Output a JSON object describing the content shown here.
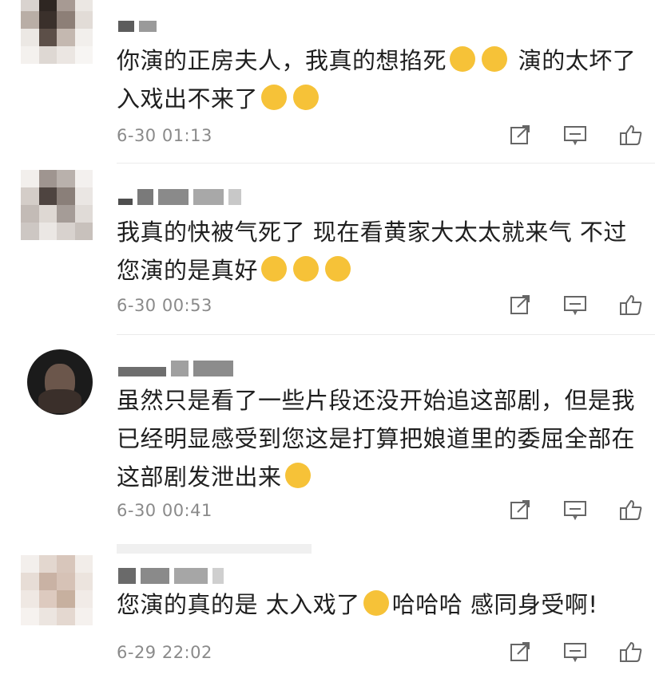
{
  "comments": [
    {
      "text_parts": [
        "你演的正房夫人，我真的想掐死",
        "演的太坏了 入戏出不来了"
      ],
      "emoji_a": [
        "grimace",
        "grimace"
      ],
      "emoji_b": [
        "laughing",
        "laughing"
      ],
      "time": "6-30 01:13"
    },
    {
      "text_parts": [
        "我真的快被气死了 现在看黄家大太太就来气 不过您演的是真好"
      ],
      "emoji_a": [
        "crying",
        "crying",
        "crying"
      ],
      "time": "6-30 00:53"
    },
    {
      "text_parts": [
        "虽然只是看了一些片段还没开始追这部剧，但是我已经明显感受到您这是打算把娘道里的委屈全部在这部剧发泄出来"
      ],
      "emoji_a": [
        "sweat-laugh"
      ],
      "time": "6-30 00:41"
    },
    {
      "text_parts": [
        "您演的真的是 太入戏了",
        "哈哈哈 感同身受啊!"
      ],
      "emoji_a": [
        "drooling"
      ],
      "time": "6-29 22:02"
    }
  ],
  "icons": {
    "share": "share-icon",
    "comment": "comment-icon",
    "like": "thumbs-up-icon"
  },
  "colors": {
    "text": "#1f1f1f",
    "time": "#8a8a8a",
    "emoji": "#f6c238",
    "icon": "#666666"
  }
}
